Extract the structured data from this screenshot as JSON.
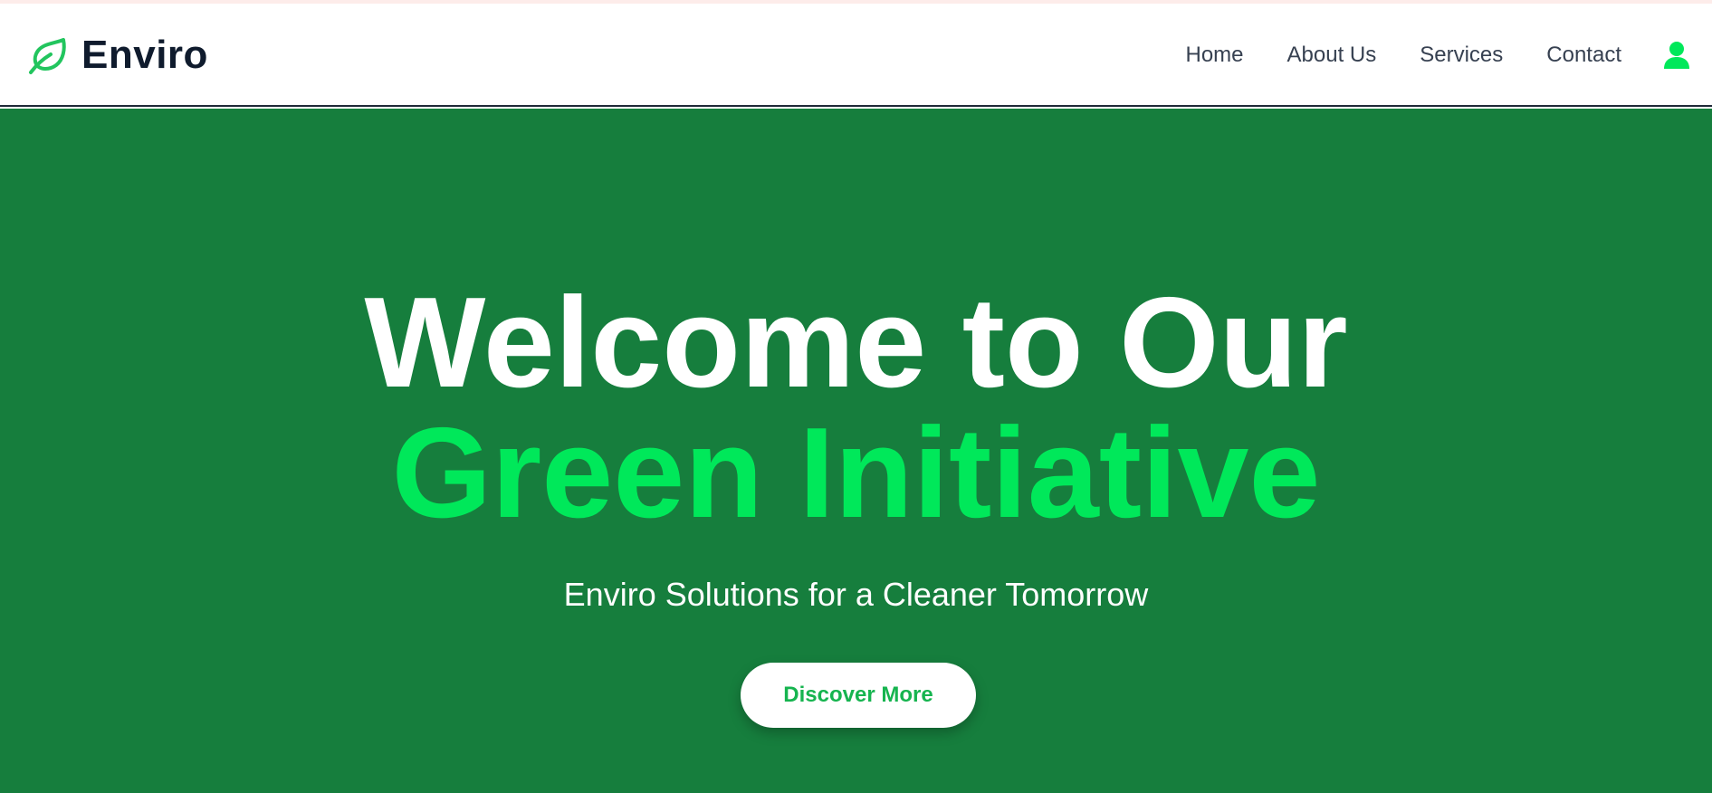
{
  "brand": {
    "name": "Enviro",
    "icon": "leaf-icon",
    "icon_color": "#22c55e"
  },
  "nav": {
    "items": [
      {
        "label": "Home"
      },
      {
        "label": "About Us"
      },
      {
        "label": "Services"
      },
      {
        "label": "Contact"
      }
    ],
    "user_icon": "user-icon",
    "user_icon_color": "#00e85a"
  },
  "hero": {
    "title_line1": "Welcome to Our",
    "title_line2": "Green Initiative",
    "subtitle": "Enviro Solutions for a Cleaner Tomorrow",
    "cta_label": "Discover More",
    "background_color": "#167e3d",
    "accent_color": "#00e85a"
  }
}
